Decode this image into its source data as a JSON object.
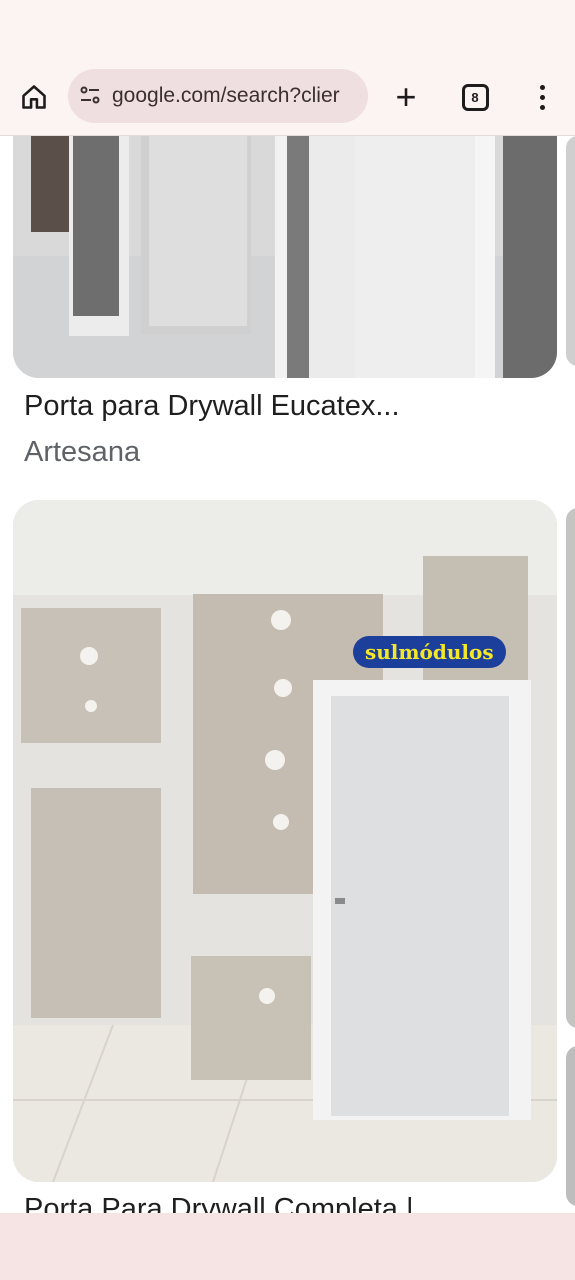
{
  "browser": {
    "url": "google.com/search?clier",
    "tab_count": "8",
    "home_icon": "home-icon",
    "site_info_icon": "tune-icon",
    "new_tab_icon": "plus-icon",
    "tabs_icon": "tab-switcher-icon",
    "menu_icon": "more-vert-icon"
  },
  "results": [
    {
      "title": "Porta para Drywall Eucatex...",
      "source": "Artesana"
    },
    {
      "title": "Porta Para Drywall Completa |",
      "watermark": "sulmódulos"
    }
  ],
  "colors": {
    "toolbar_bg": "#fcf4f2",
    "urlbar_bg": "#efdfe0",
    "bottom_bar": "#f6e4e5",
    "badge_bg": "#1c3f9c",
    "badge_text": "#f4e628"
  }
}
